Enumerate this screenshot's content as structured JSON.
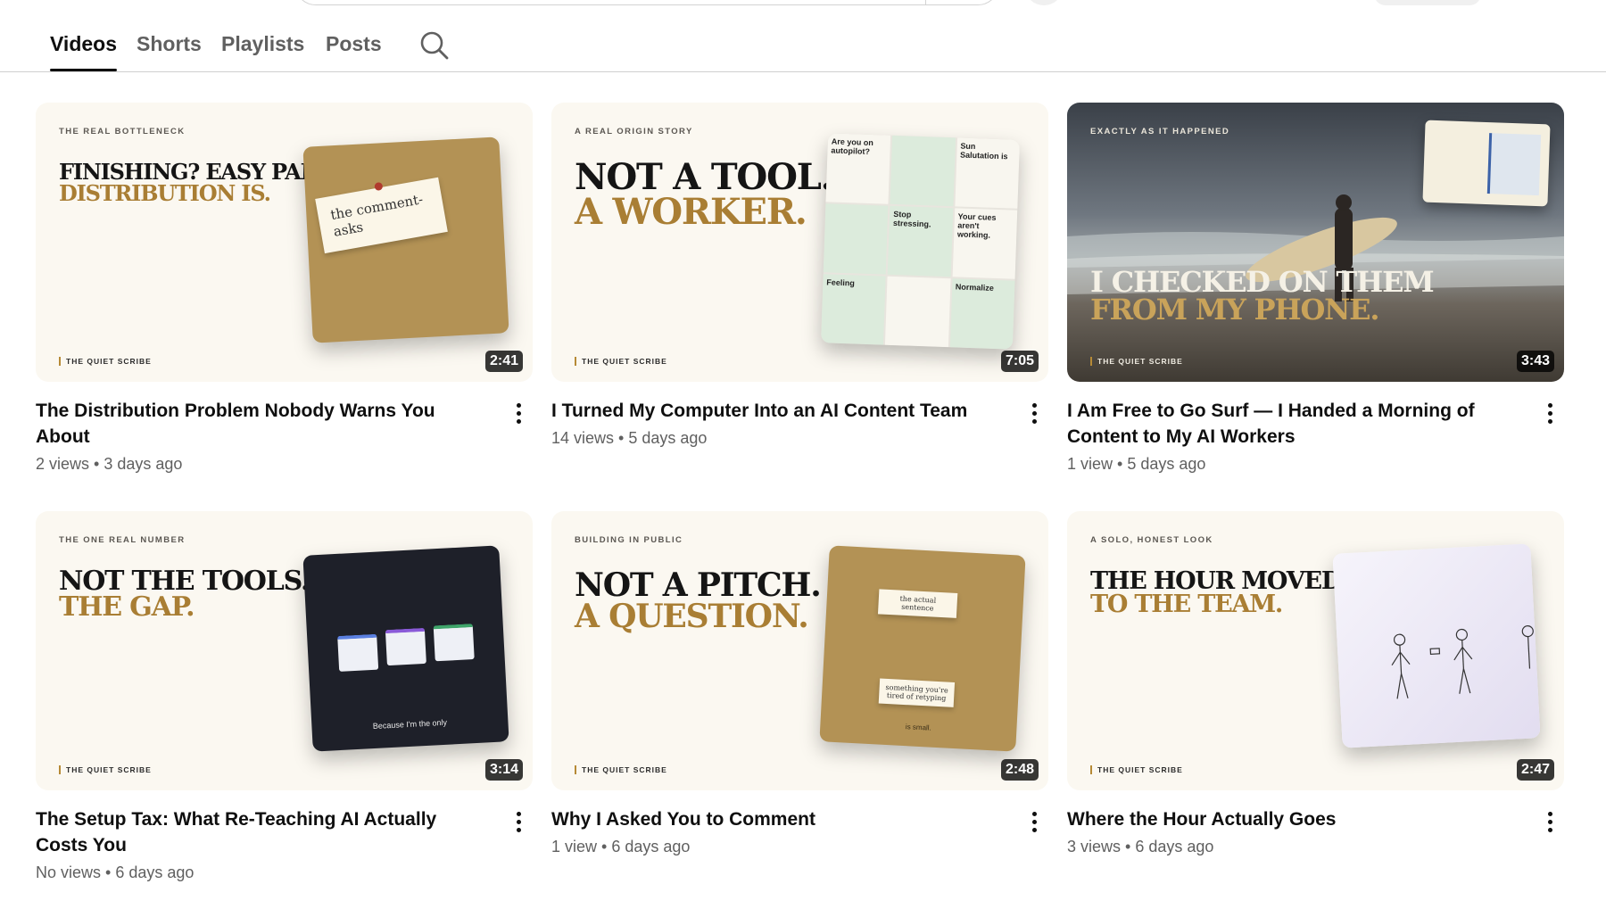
{
  "tabs": [
    {
      "label": "Videos",
      "active": true
    },
    {
      "label": "Shorts",
      "active": false
    },
    {
      "label": "Playlists",
      "active": false
    },
    {
      "label": "Posts",
      "active": false
    }
  ],
  "colors": {
    "accent_gold": "#a97e34",
    "text": "#0f0f0f",
    "muted": "#606060"
  },
  "videos": [
    {
      "title": "The Distribution Problem Nobody Warns You About",
      "stats": "2 views • 3 days ago",
      "duration": "2:41",
      "thumb": {
        "kicker": "THE REAL BOTTLENECK",
        "line1": "FINISHING? EASY PART.",
        "line2": "DISTRIBUTION IS.",
        "brand": "THE QUIET SCRIBE",
        "note": "the comment-asks"
      }
    },
    {
      "title": "I Turned My Computer Into an AI Content Team",
      "stats": "14 views • 5 days ago",
      "duration": "7:05",
      "thumb": {
        "kicker": "A REAL ORIGIN STORY",
        "line1": "NOT A TOOL.",
        "line2": "A WORKER.",
        "brand": "THE QUIET SCRIBE",
        "tiles": [
          "Are you on autopilot?",
          "Sun Salutation is",
          "Stop stressing.",
          "Your cues aren't working.",
          "Feeling",
          "Normalize"
        ]
      }
    },
    {
      "title": "I Am Free to Go Surf — I Handed a Morning of Content to My AI Workers",
      "stats": "1 view • 5 days ago",
      "duration": "3:43",
      "thumb": {
        "kicker": "EXACTLY AS IT HAPPENED",
        "line1": "I CHECKED ON THEM",
        "line2": "FROM MY PHONE.",
        "brand": "THE QUIET SCRIBE"
      }
    },
    {
      "title": "The Setup Tax: What Re-Teaching AI Actually Costs You",
      "stats": "No views • 6 days ago",
      "duration": "3:14",
      "thumb": {
        "kicker": "THE ONE REAL NUMBER",
        "line1": "NOT THE TOOLS.",
        "line2": "THE GAP.",
        "brand": "THE QUIET SCRIBE",
        "caption": "Because I'm the only"
      }
    },
    {
      "title": "Why I Asked You to Comment",
      "stats": "1 view • 6 days ago",
      "duration": "2:48",
      "thumb": {
        "kicker": "BUILDING IN PUBLIC",
        "line1": "NOT A PITCH.",
        "line2": "A QUESTION.",
        "brand": "THE QUIET SCRIBE",
        "note1": "the actual sentence",
        "note2": "something you're tired of retyping",
        "caption": "is small."
      }
    },
    {
      "title": "Where the Hour Actually Goes",
      "stats": "3 views • 6 days ago",
      "duration": "2:47",
      "thumb": {
        "kicker": "A SOLO, HONEST LOOK",
        "line1": "THE HOUR MOVED.",
        "line2": "TO THE TEAM.",
        "brand": "THE QUIET SCRIBE"
      }
    }
  ]
}
